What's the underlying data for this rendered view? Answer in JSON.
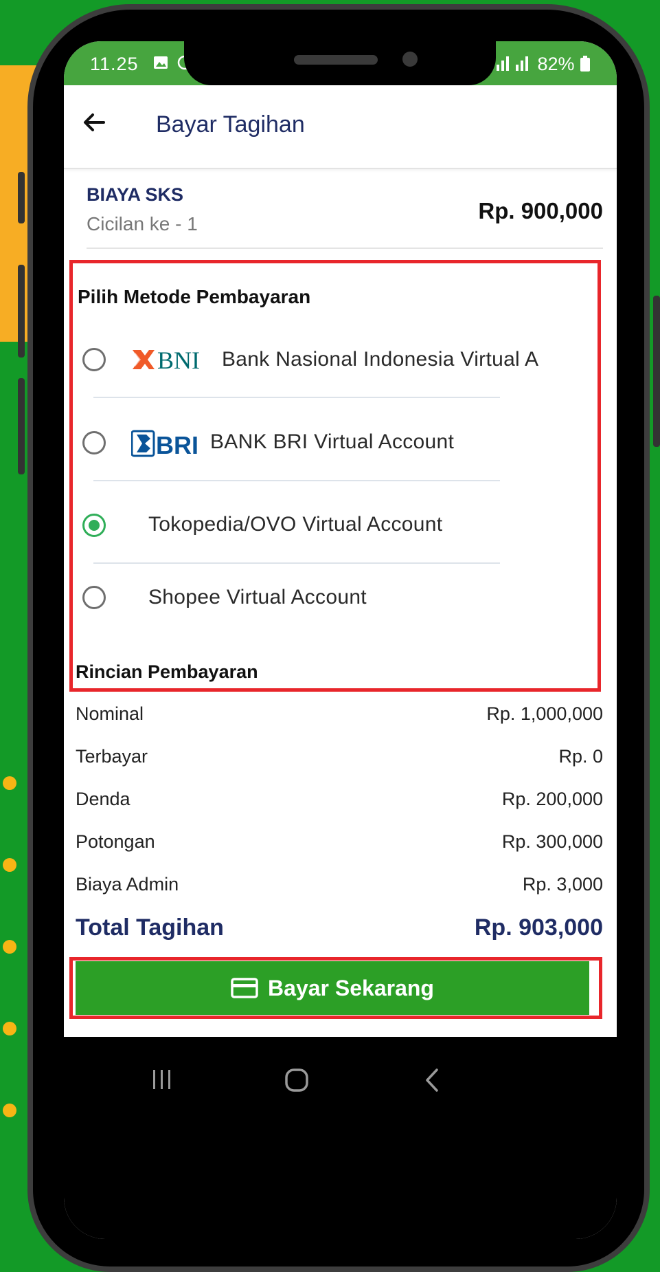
{
  "status_bar": {
    "time": "11.25",
    "left_icons": [
      "image-icon",
      "whatsapp-icon"
    ],
    "battery": "82%"
  },
  "app_bar": {
    "title": "Bayar Tagihan"
  },
  "bill": {
    "title": "BIAYA SKS",
    "subtitle": "Cicilan ke - 1",
    "amount": "Rp. 900,000"
  },
  "payment_methods": {
    "title": "Pilih Metode Pembayaran",
    "items": [
      {
        "logo": "BNI",
        "label": "Bank Nasional Indonesia Virtual A",
        "selected": false
      },
      {
        "logo": "BRI",
        "label": "BANK BRI Virtual Account",
        "selected": false
      },
      {
        "logo": "",
        "label": "Tokopedia/OVO Virtual Account",
        "selected": true
      },
      {
        "logo": "",
        "label": "Shopee Virtual Account",
        "selected": false
      }
    ]
  },
  "details": {
    "title": "Rincian Pembayaran",
    "rows": [
      {
        "label": "Nominal",
        "value": "Rp. 1,000,000"
      },
      {
        "label": "Terbayar",
        "value": "Rp. 0"
      },
      {
        "label": "Denda",
        "value": "Rp. 200,000"
      },
      {
        "label": "Potongan",
        "value": "Rp. 300,000"
      },
      {
        "label": "Biaya Admin",
        "value": "Rp. 3,000"
      }
    ],
    "total_label": "Total Tagihan",
    "total_value": "Rp. 903,000"
  },
  "pay_button": {
    "label": "Bayar Sekarang",
    "icon": "credit-card-icon"
  },
  "nav_bar": {
    "items": [
      "recent-apps-icon",
      "home-icon",
      "back-icon"
    ]
  },
  "colors": {
    "background_green": "#139a27",
    "accent_orange": "#f7ad24",
    "navy": "#1f2c64",
    "highlight_red": "#e8262b",
    "button_green": "#2c9f26",
    "radio_green": "#2fae58"
  }
}
